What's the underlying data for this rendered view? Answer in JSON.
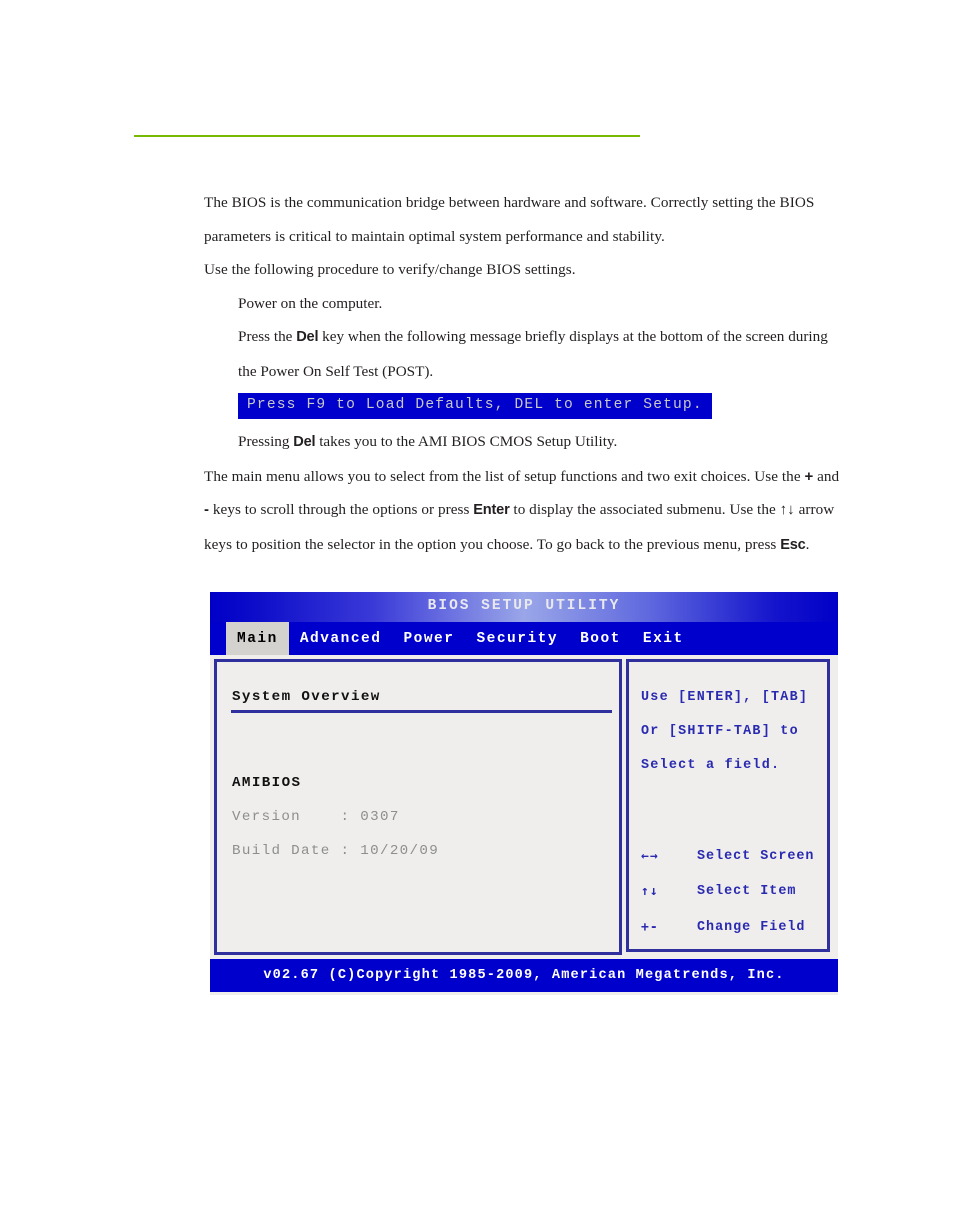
{
  "page": {
    "accent_rule_color": "#76b900"
  },
  "doc": {
    "intro": [
      "The BIOS is the communication bridge between hardware and software. Correctly setting the BIOS parameters is critical to maintain optimal system performance and stability.",
      "Use the following procedure to verify/change BIOS settings."
    ],
    "steps": {
      "step1": "Power on the computer.",
      "step2_pre": "Press the ",
      "step2_key": "Del",
      "step2_post": " key when the following message briefly displays at the bottom of the screen during the Power On Self Test (POST).",
      "post_message": "Press F9 to Load Defaults, DEL to enter Setup.",
      "step3_pre": "Pressing ",
      "step3_key": "Del",
      "step3_post": " takes you to the AMI BIOS CMOS Setup Utility."
    },
    "closing": {
      "seg1": "The main menu allows you to select from the list of setup functions and two exit choices. Use the ",
      "key_plus": "+",
      "seg2": " and ",
      "key_minus": "-",
      "seg3": " keys to scroll through the options or press ",
      "key_enter": "Enter",
      "seg4": " to display the associated submenu. Use the ",
      "key_arrows": "↑↓",
      "seg5": " arrow keys to position the selector in the option you choose. To go back to the previous menu, press ",
      "key_esc": "Esc",
      "seg6": "."
    }
  },
  "bios": {
    "title": "BIOS SETUP UTILITY",
    "menu": [
      {
        "label": "Main",
        "active": true
      },
      {
        "label": "Advanced",
        "active": false
      },
      {
        "label": "Power",
        "active": false
      },
      {
        "label": "Security",
        "active": false
      },
      {
        "label": "Boot",
        "active": false
      },
      {
        "label": "Exit",
        "active": false
      }
    ],
    "main_panel": {
      "heading": "System Overview",
      "vendor": "AMIBIOS",
      "fields": [
        {
          "label": "Version",
          "value": "Version    : 0307"
        },
        {
          "label": "Build Date",
          "value": "Build Date : 10/20/09"
        }
      ]
    },
    "help_panel": {
      "lines": [
        "Use [ENTER], [TAB]",
        "Or [SHITF-TAB] to",
        "Select a field."
      ],
      "legend": [
        {
          "key": "←→",
          "desc": "Select Screen"
        },
        {
          "key": "↑↓",
          "desc": "Select Item"
        },
        {
          "key": "+-",
          "desc": "Change Field"
        }
      ]
    },
    "footer": "v02.67 (C)Copyright 1985-2009, American Megatrends, Inc.",
    "colors": {
      "chrome_blue": "#0000cc",
      "panel_border": "#2f2f9e",
      "panel_bg": "#efeeed",
      "active_tab_bg": "#d4d2cf",
      "help_text": "#2a2ab0",
      "value_text": "#8e8e8e"
    }
  }
}
